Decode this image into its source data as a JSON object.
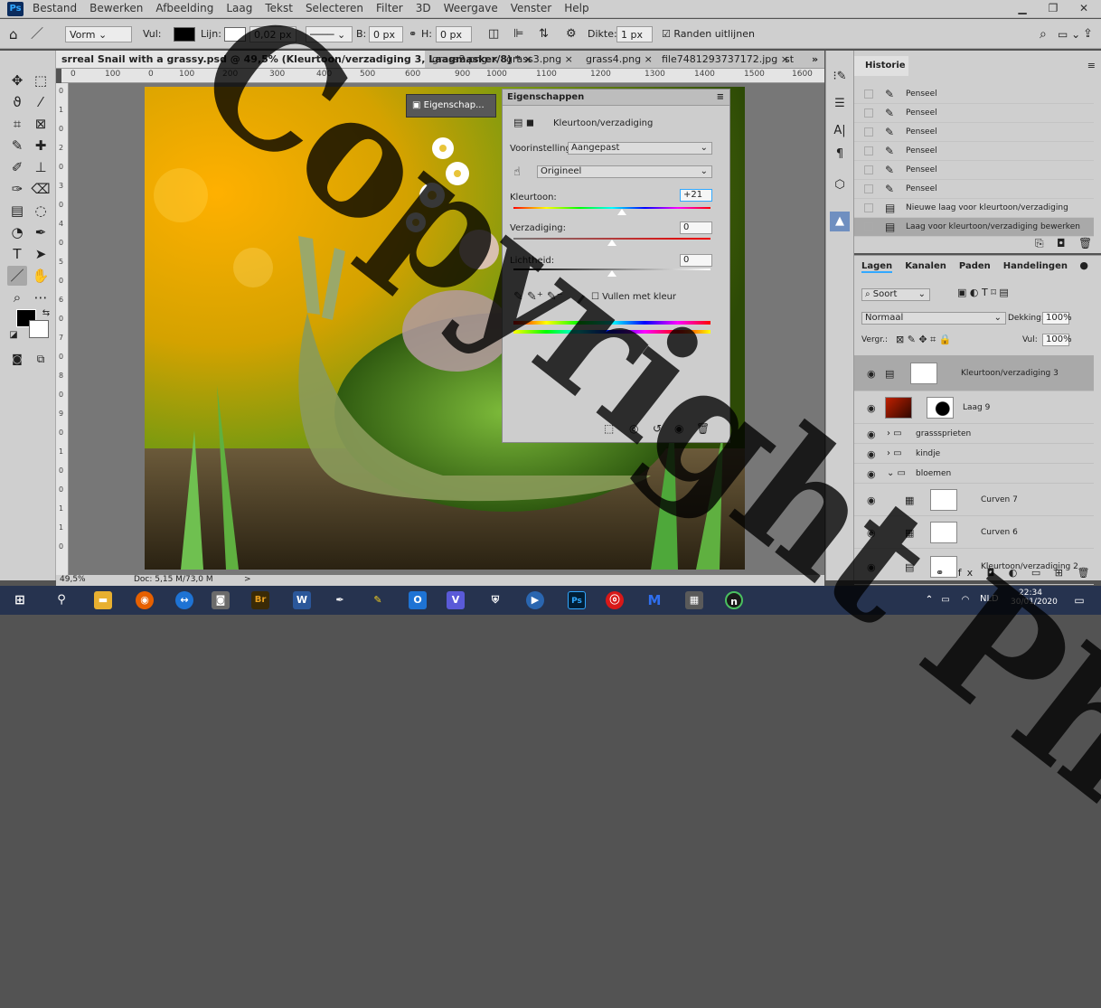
{
  "menubar": {
    "items": [
      "Bestand",
      "Bewerken",
      "Afbeelding",
      "Laag",
      "Tekst",
      "Selecteren",
      "Filter",
      "3D",
      "Weergave",
      "Venster",
      "Help"
    ]
  },
  "options": {
    "mode": "Vorm",
    "fill_label": "Vul:",
    "stroke_label": "Lijn:",
    "stroke_width": "0,02 px",
    "b_label": "B:",
    "b_value": "0 px",
    "h_label": "H:",
    "h_value": "0 px",
    "thickness_label": "Dikte:",
    "thickness_value": "1 px",
    "align_edges": "Randen uitlijnen"
  },
  "tabs": [
    {
      "label": "srreal Snail with a grassy.psd @ 49,5% (Kleurtoon/verzadiging 3, Laagmasker/8) *",
      "close": "×"
    },
    {
      "label": "grass2.png",
      "close": "×"
    },
    {
      "label": "grass3.png",
      "close": "×"
    },
    {
      "label": "grass4.png",
      "close": "×"
    },
    {
      "label": "file7481293737172.jpg",
      "close": "×"
    },
    {
      "label": "st",
      "close": ""
    }
  ],
  "tabs_overflow": "»",
  "ruler_h": [
    "0",
    "100",
    "0",
    "100",
    "200",
    "300",
    "400",
    "500",
    "600",
    "900",
    "1000",
    "1100",
    "1200",
    "1300",
    "1400",
    "1500",
    "1600"
  ],
  "ruler_v": [
    "0",
    "1",
    "0",
    "2",
    "0",
    "3",
    "0",
    "4",
    "0",
    "5",
    "0",
    "6",
    "0",
    "7",
    "0",
    "8",
    "0",
    "9",
    "0",
    "1",
    "0",
    "0",
    "1",
    "1",
    "0"
  ],
  "status": {
    "zoom": "49,5%",
    "doc": "Doc: 5,15 M/73,0 M",
    "arrow": ">"
  },
  "props_mini": {
    "label": "Eigenschap..."
  },
  "properties": {
    "title": "Eigenschappen",
    "layer_type": "Kleurtoon/verzadiging",
    "preset_label": "Voorinstelling:",
    "preset_value": "Aangepast",
    "channel_value": "Origineel",
    "hue_label": "Kleurtoon:",
    "hue_value": "+21",
    "sat_label": "Verzadiging:",
    "sat_value": "0",
    "light_label": "Lichtheid:",
    "light_value": "0",
    "colorize_label": "Vullen met kleur",
    "hue_level": 0.55,
    "sat_level": 0.5,
    "light_level": 0.5
  },
  "history": {
    "title": "Historie",
    "items": [
      {
        "icon": "brush",
        "label": "Penseel"
      },
      {
        "icon": "brush",
        "label": "Penseel"
      },
      {
        "icon": "brush",
        "label": "Penseel"
      },
      {
        "icon": "brush",
        "label": "Penseel"
      },
      {
        "icon": "brush",
        "label": "Penseel"
      },
      {
        "icon": "brush",
        "label": "Penseel"
      },
      {
        "icon": "doc",
        "label": "Nieuwe laag voor kleurtoon/verzadiging"
      },
      {
        "icon": "doc",
        "label": "Laag voor kleurtoon/verzadiging bewerken"
      }
    ]
  },
  "layers": {
    "tabs": [
      "Lagen",
      "Kanalen",
      "Paden",
      "Handelingen"
    ],
    "filter": "Soort",
    "blend": "Normaal",
    "opacity_label": "Dekking:",
    "opacity_value": "100%",
    "lock_label": "Vergr.:",
    "fill_label": "Vul:",
    "fill_value": "100%",
    "items": [
      {
        "name": "Kleurtoon/verzadiging 3",
        "kind": "adjust"
      },
      {
        "name": "Laag 9",
        "kind": "image"
      },
      {
        "name": "grasssprieten",
        "kind": "group"
      },
      {
        "name": "kindje",
        "kind": "group"
      },
      {
        "name": "bloemen",
        "kind": "group-open"
      },
      {
        "name": "Curven 7",
        "kind": "curves"
      },
      {
        "name": "Curven 6",
        "kind": "curves"
      },
      {
        "name": "Kleurtoon/verzadiging 2",
        "kind": "adjust"
      }
    ]
  },
  "taskbar": {
    "lang": "NLD",
    "time": "22:34",
    "date": "30/01/2020"
  },
  "watermark": {
    "text": "Copyright Photo"
  },
  "colors": {
    "accent": "#31a8ff",
    "taskbar": "#26334f",
    "panel": "#cfcfcf"
  }
}
